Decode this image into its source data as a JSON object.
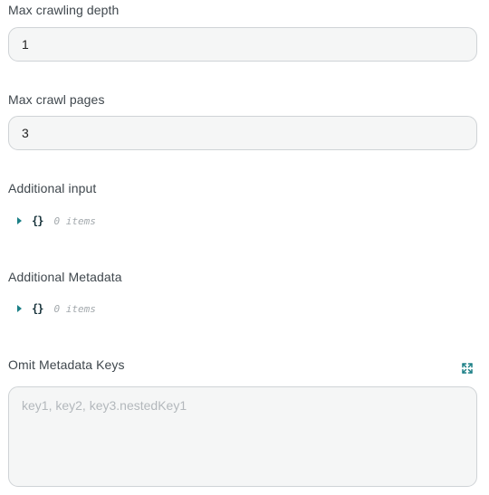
{
  "fields": {
    "max_depth": {
      "label": "Max crawling depth",
      "value": "1"
    },
    "max_pages": {
      "label": "Max crawl pages",
      "value": "3"
    },
    "additional_input": {
      "label": "Additional input",
      "braces": "{}",
      "count": "0 items"
    },
    "additional_metadata": {
      "label": "Additional Metadata",
      "braces": "{}",
      "count": "0 items"
    },
    "omit_metadata_keys": {
      "label": "Omit Metadata Keys",
      "placeholder": "key1, key2, key3.nestedKey1",
      "value": ""
    }
  },
  "icons": {
    "json_caret": "caret-right-icon",
    "expand": "expand-icon"
  },
  "colors": {
    "accent": "#1b7f86",
    "input_background": "#f5f6f6",
    "input_border": "#cfd3d6"
  }
}
